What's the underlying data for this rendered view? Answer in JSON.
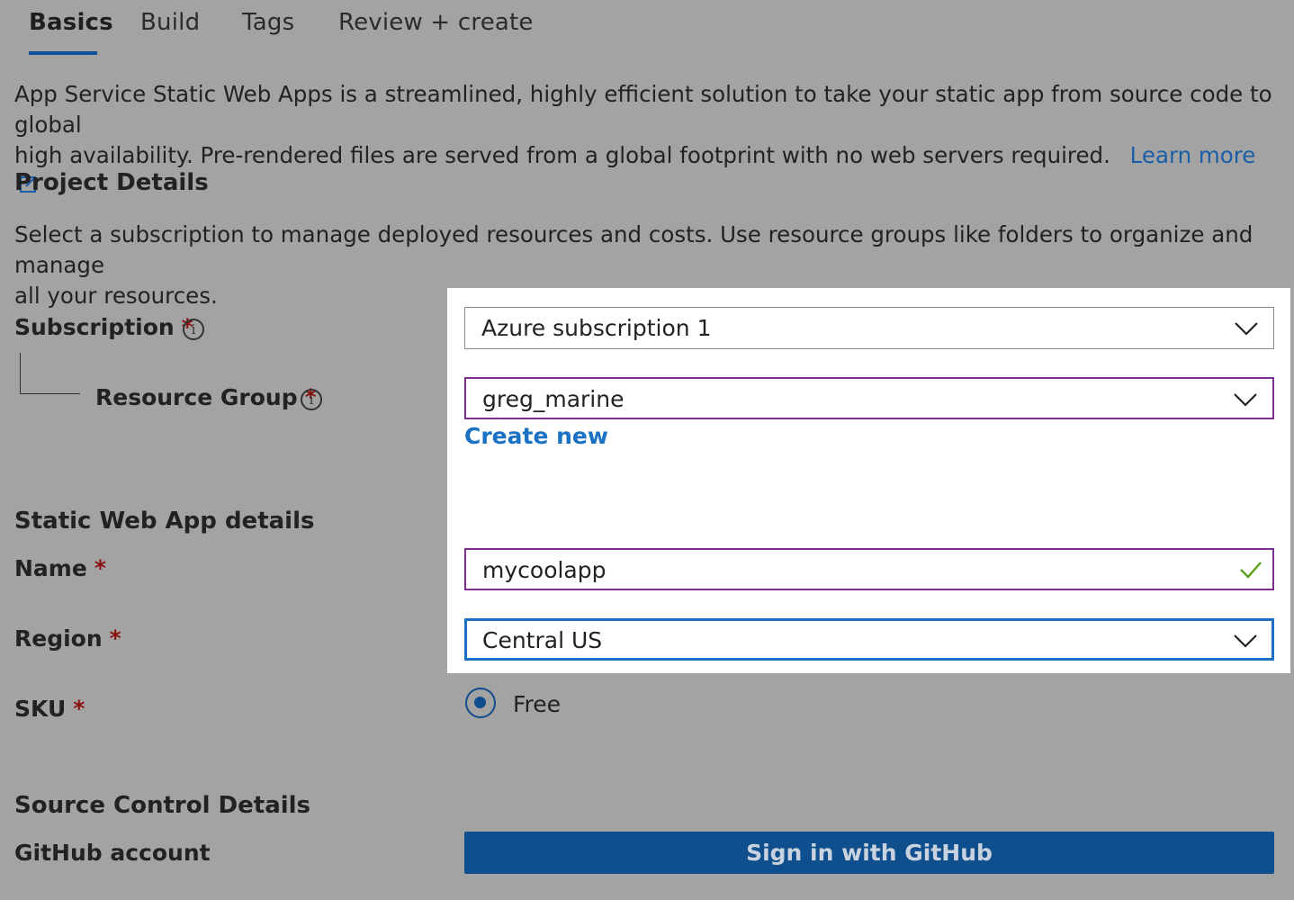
{
  "tabs": [
    {
      "label": "Basics",
      "active": true
    },
    {
      "label": "Build",
      "active": false
    },
    {
      "label": "Tags",
      "active": false
    },
    {
      "label": "Review + create",
      "active": false
    }
  ],
  "intro": {
    "line1": "App Service Static Web Apps is a streamlined, highly efficient solution to take your static app from source code to global",
    "line2": "high availability. Pre-rendered files are served from a global footprint with no web servers required.",
    "learn_more": "Learn more"
  },
  "project_details": {
    "title": "Project Details",
    "description_line1": "Select a subscription to manage deployed resources and costs. Use resource groups like folders to organize and manage",
    "description_line2": "all your resources.",
    "subscription_label": "Subscription",
    "subscription_value": "Azure subscription 1",
    "resource_group_label": "Resource Group",
    "resource_group_value": "greg_marine",
    "create_new": "Create new"
  },
  "app_details": {
    "title": "Static Web App details",
    "name_label": "Name",
    "name_value": "mycoolapp",
    "region_label": "Region",
    "region_value": "Central US",
    "sku_label": "SKU",
    "sku_value": "Free"
  },
  "source_control": {
    "title": "Source Control Details",
    "github_label": "GitHub account",
    "github_button": "Sign in with GitHub"
  },
  "required_marker": "*",
  "info_glyph": "i",
  "colors": {
    "background": "#a3a3a3",
    "tab_underline": "#10529a",
    "link": "#1b71c4",
    "required": "#8a1010",
    "focused_field_border": "#1b71c4",
    "validated_field_border": "#7a2e8e",
    "valid_check": "#5a9e1c",
    "button": "#104f8e"
  },
  "icons": [
    "info-icon",
    "chevron-down-icon",
    "checkmark-icon",
    "external-link-icon",
    "radio-selected-icon"
  ]
}
